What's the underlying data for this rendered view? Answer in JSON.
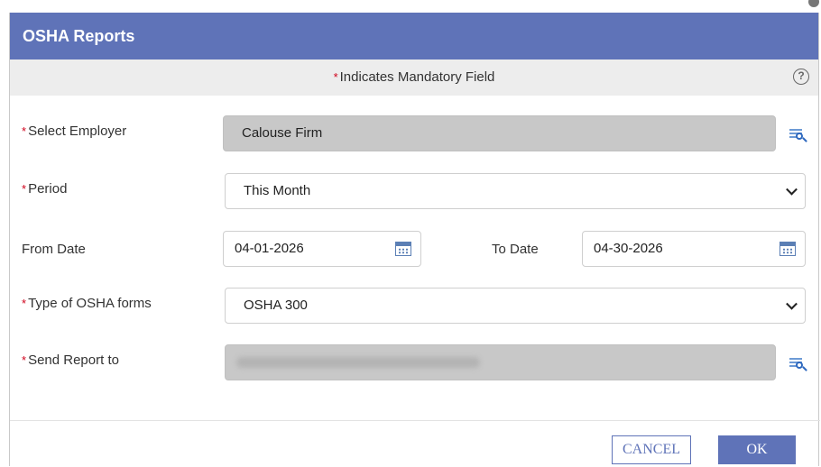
{
  "dialog": {
    "title": "OSHA Reports",
    "mandatory_note": "Indicates Mandatory Field",
    "required_marker": "*"
  },
  "form": {
    "employer": {
      "label": "Select Employer",
      "value": "Calouse Firm",
      "required": true
    },
    "period": {
      "label": "Period",
      "value": "This Month",
      "required": true
    },
    "from_date": {
      "label": "From Date",
      "value": "04-01-2026"
    },
    "to_date": {
      "label": "To Date",
      "value": "04-30-2026"
    },
    "osha_form_type": {
      "label": "Type of OSHA forms",
      "value": "OSHA 300",
      "required": true
    },
    "send_report_to": {
      "label": "Send Report to",
      "value": "",
      "required": true
    }
  },
  "buttons": {
    "cancel": "CANCEL",
    "ok": "OK"
  },
  "icons": {
    "help": "help-icon",
    "lookup": "lookup-icon",
    "calendar": "calendar-icon",
    "dropdown": "chevron-down-icon"
  },
  "colors": {
    "header": "#5f73b8",
    "required": "#d0021b",
    "readonly_field": "#c8c8c8",
    "mandatory_bar": "#ededed"
  }
}
